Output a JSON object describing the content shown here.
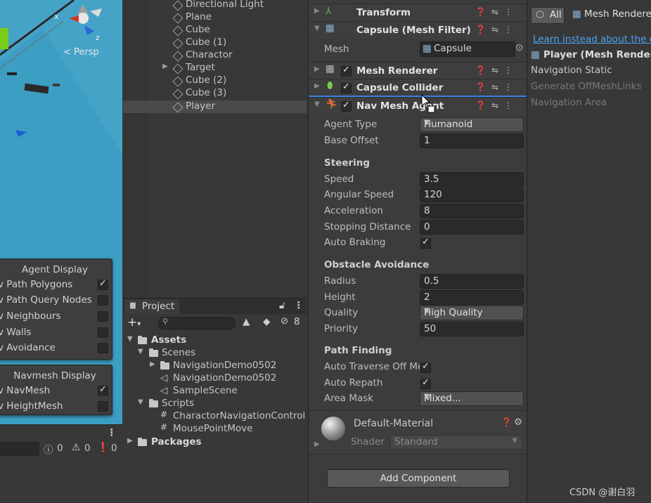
{
  "scene": {
    "persp_label": "Persp",
    "axis_x": "x",
    "axis_z": "z",
    "agent_display": {
      "title": "Agent Display",
      "items": [
        {
          "label": "v Path Polygons",
          "checked": true
        },
        {
          "label": "v Path Query Nodes",
          "checked": false
        },
        {
          "label": "v Neighbours",
          "checked": false
        },
        {
          "label": "v Walls",
          "checked": false
        },
        {
          "label": "v Avoidance",
          "checked": false
        }
      ]
    },
    "navmesh_display": {
      "title": "Navmesh Display",
      "items": [
        {
          "label": "v NavMesh",
          "checked": true
        },
        {
          "label": "v HeightMesh",
          "checked": false
        }
      ]
    }
  },
  "console": {
    "info_count": "0",
    "warn_count": "0",
    "error_count": "0"
  },
  "hierarchy": {
    "items": [
      {
        "label": "Directional Light"
      },
      {
        "label": "Plane"
      },
      {
        "label": "Cube"
      },
      {
        "label": "Cube (1)"
      },
      {
        "label": "Charactor"
      },
      {
        "label": "Target"
      },
      {
        "label": "Cube (2)"
      },
      {
        "label": "Cube (3)"
      },
      {
        "label": "Player"
      }
    ]
  },
  "project": {
    "tab_label": "Project",
    "hidden_count": "8",
    "tree": [
      {
        "label": "Assets"
      },
      {
        "label": "Scenes"
      },
      {
        "label": "NavigationDemo0502"
      },
      {
        "label": "NavigationDemo0502"
      },
      {
        "label": "SampleScene"
      },
      {
        "label": "Scripts"
      },
      {
        "label": "CharactorNavigationControl"
      },
      {
        "label": "MousePointMove"
      },
      {
        "label": "Packages"
      }
    ]
  },
  "inspector": {
    "components": [
      {
        "name": "Transform"
      },
      {
        "name": "Capsule (Mesh Filter)"
      },
      {
        "name": "Mesh Renderer"
      },
      {
        "name": "Capsule Collider"
      },
      {
        "name": "Nav Mesh Agent"
      }
    ],
    "mesh_label": "Mesh",
    "mesh_value": "Capsule",
    "agent_type_label": "Agent Type",
    "agent_type_value": "Humanoid",
    "base_offset_label": "Base Offset",
    "base_offset_value": "1",
    "steering_header": "Steering",
    "speed_label": "Speed",
    "speed_value": "3.5",
    "angular_speed_label": "Angular Speed",
    "angular_speed_value": "120",
    "acceleration_label": "Acceleration",
    "acceleration_value": "8",
    "stopping_distance_label": "Stopping Distance",
    "stopping_distance_value": "0",
    "auto_braking_label": "Auto Braking",
    "obstacle_header": "Obstacle Avoidance",
    "radius_label": "Radius",
    "radius_value": "0.5",
    "height_label": "Height",
    "height_value": "2",
    "quality_label": "Quality",
    "quality_value": "High Quality",
    "priority_label": "Priority",
    "priority_value": "50",
    "pathfinding_header": "Path Finding",
    "auto_traverse_label": "Auto Traverse Off Me",
    "auto_repath_label": "Auto Repath",
    "area_mask_label": "Area Mask",
    "area_mask_value": "Mixed...",
    "material_name": "Default-Material",
    "shader_label": "Shader",
    "shader_value": "Standard",
    "add_component_label": "Add Component"
  },
  "right_panel": {
    "filter_all": "All",
    "filter_mesh": "Mesh Renderer",
    "learn_link": "Learn instead about the co",
    "player_label": "Player (Mesh Renderer",
    "nav_static": "Navigation Static",
    "generate_links": "Generate OffMeshLinks",
    "navigation_area": "Navigation Area"
  },
  "watermark": "CSDN @谢白羽"
}
